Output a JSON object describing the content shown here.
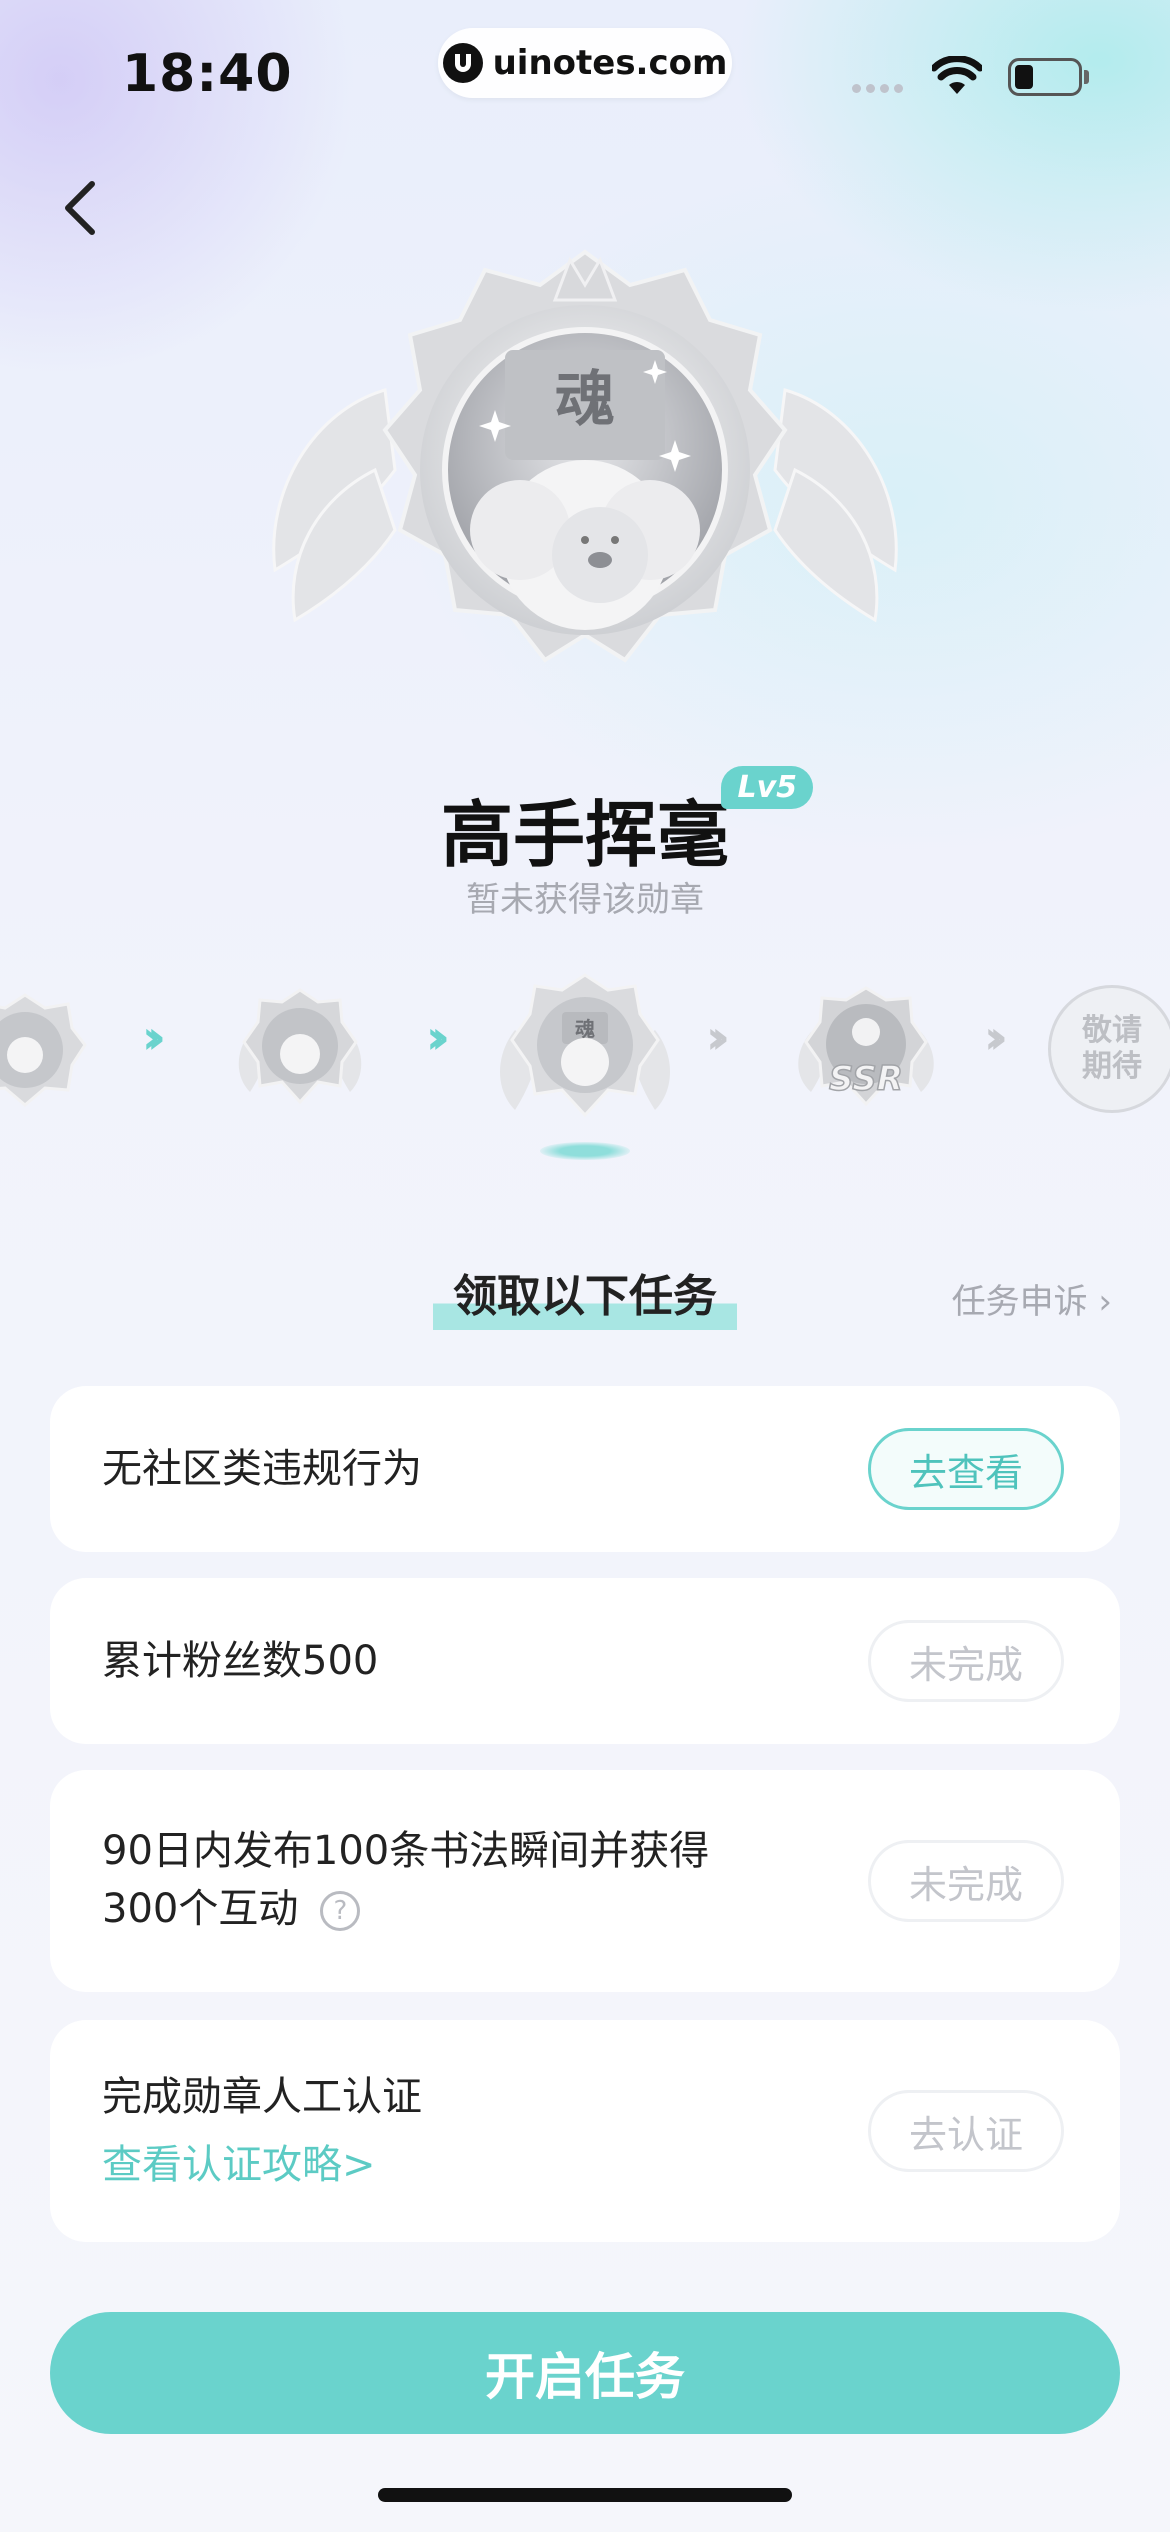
{
  "status_bar": {
    "time": "18:40",
    "url": "uinotes.com",
    "icons": [
      "signal-icon",
      "wifi-icon",
      "battery-icon"
    ]
  },
  "nav": {
    "back_icon": "chevron-left-icon"
  },
  "medal": {
    "emblem_char": "魂",
    "title": "高手挥毫",
    "level": "Lv5",
    "status": "暂未获得该勋章"
  },
  "levels": {
    "items": [
      "medal-level-3",
      "medal-level-4",
      "medal-level-5-current",
      "medal-level-ssr"
    ],
    "ssr_label": "SSR",
    "expect_line1": "敬请",
    "expect_line2": "期待"
  },
  "section": {
    "title": "领取以下任务",
    "appeal": "任务申诉 ›"
  },
  "tasks": [
    {
      "text": "无社区类违规行为",
      "button": "去查看",
      "state": "active"
    },
    {
      "text": "累计粉丝数500",
      "button": "未完成",
      "state": "muted"
    },
    {
      "text_line1": "90日内发布100条书法瞬间并获得",
      "text_line2": "300个互动",
      "help": "?",
      "button": "未完成",
      "state": "muted"
    },
    {
      "text": "完成勋章人工认证",
      "link": "查看认证攻略>",
      "button": "去认证",
      "state": "muted"
    }
  ],
  "cta": {
    "label": "开启任务"
  },
  "colors": {
    "accent": "#6ad3cd",
    "accent_text": "#4fc3bc",
    "muted": "#c3c5cb"
  }
}
